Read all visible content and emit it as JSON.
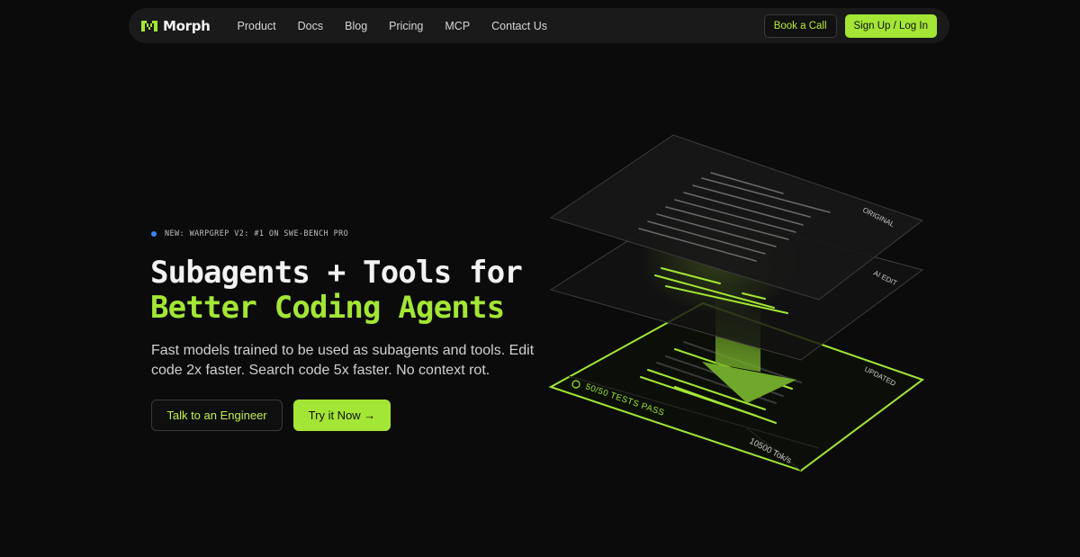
{
  "nav": {
    "brand": "Morph",
    "links": [
      "Product",
      "Docs",
      "Blog",
      "Pricing",
      "MCP",
      "Contact Us"
    ],
    "book_call": "Book a Call",
    "signup": "Sign Up / Log In"
  },
  "hero": {
    "badge": "NEW: WARPGREP V2: #1 ON SWE-BENCH PRO",
    "title_line1": "Subagents + Tools for",
    "title_line2": "Better Coding Agents",
    "subtitle": "Fast models trained to be used as subagents and tools. Edit code 2x faster. Search code 5x faster. No context rot.",
    "cta_secondary": "Talk to an Engineer",
    "cta_primary": "Try it Now →"
  },
  "illustration": {
    "layer_original": "ORIGINAL",
    "layer_ai_edit": "AI EDIT",
    "layer_updated": "UPDATED",
    "tests": "50/50 TESTS PASS",
    "speed": "10500 Tok/s"
  },
  "colors": {
    "accent": "#a3e635",
    "background": "#0b0b0b",
    "badge_dot": "#3b82f6"
  }
}
